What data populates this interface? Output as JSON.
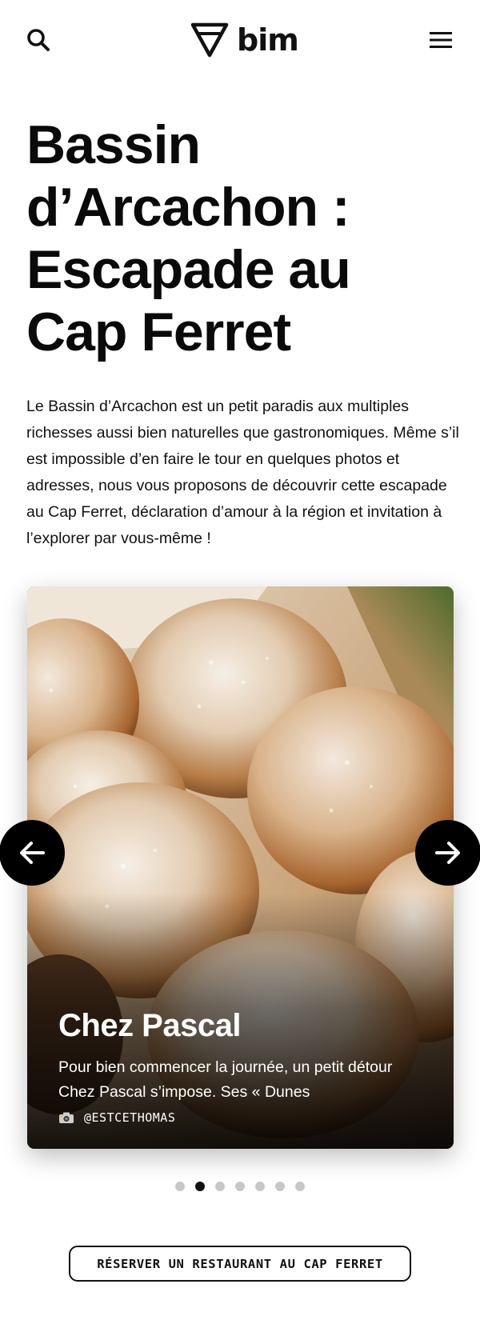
{
  "header": {
    "logo_text": "bim",
    "search_icon": "search-icon",
    "menu_icon": "hamburger-menu-icon"
  },
  "article": {
    "title_lines": [
      "Bassin",
      "d’Arcachon :",
      "Escapade au",
      "Cap Ferret"
    ],
    "intro": "Le Bassin d’Arcachon est un petit paradis aux multiples richesses aussi bien naturelles que gastronomiques. Même s’il est impossible d’en faire le tour en quelques photos et adresses, nous vous proposons de découvrir cette escapade au Cap Ferret, déclaration d’amour à la région et invitation à l’explorer par vous-même !"
  },
  "carousel": {
    "slide": {
      "title": "Chez Pascal",
      "description": "Pour bien commencer la journée, un petit détour Chez Pascal s’impose. Ses « Dunes",
      "credit": "@ESTCETHOMAS",
      "credit_icon": "camera-icon"
    },
    "prev_icon": "arrow-left-icon",
    "next_icon": "arrow-right-icon",
    "slide_count": 7,
    "active_index": 1
  },
  "cta": {
    "label": "RÉSERVER UN RESTAURANT AU CAP FERRET"
  }
}
